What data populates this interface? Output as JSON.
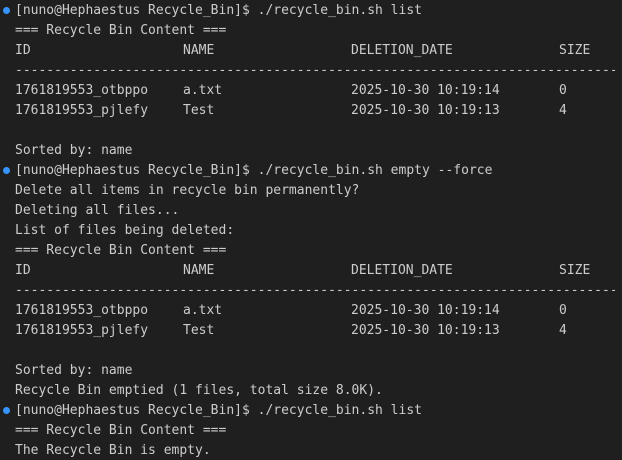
{
  "theme": {
    "background": "#1f1f1f",
    "foreground": "#cccccc",
    "prompt_dot": "#3794ff"
  },
  "prompt_dot_icon": "circle-icon",
  "lines": [
    {
      "type": "prompt",
      "text": "[nuno@Hephaestus Recycle_Bin]$ ./recycle_bin.sh list"
    },
    {
      "type": "text",
      "text": "=== Recycle Bin Content ==="
    },
    {
      "type": "row",
      "cells": [
        "ID",
        "NAME",
        "DELETION_DATE",
        "SIZE"
      ]
    },
    {
      "type": "sep",
      "text": "--------------------------------------------------------------------------------"
    },
    {
      "type": "row",
      "cells": [
        "1761819553_otbppo",
        "a.txt",
        "2025-10-30 10:19:14",
        "0"
      ]
    },
    {
      "type": "row",
      "cells": [
        "1761819553_pjlefy",
        "Test",
        "2025-10-30 10:19:13",
        "4"
      ]
    },
    {
      "type": "blank",
      "text": ""
    },
    {
      "type": "text",
      "text": "Sorted by: name"
    },
    {
      "type": "prompt",
      "text": "[nuno@Hephaestus Recycle_Bin]$ ./recycle_bin.sh empty --force"
    },
    {
      "type": "text",
      "text": "Delete all items in recycle bin permanently?"
    },
    {
      "type": "text",
      "text": "Deleting all files..."
    },
    {
      "type": "text",
      "text": "List of files being deleted:"
    },
    {
      "type": "text",
      "text": "=== Recycle Bin Content ==="
    },
    {
      "type": "row",
      "cells": [
        "ID",
        "NAME",
        "DELETION_DATE",
        "SIZE"
      ]
    },
    {
      "type": "sep",
      "text": "--------------------------------------------------------------------------------"
    },
    {
      "type": "row",
      "cells": [
        "1761819553_otbppo",
        "a.txt",
        "2025-10-30 10:19:14",
        "0"
      ]
    },
    {
      "type": "row",
      "cells": [
        "1761819553_pjlefy",
        "Test",
        "2025-10-30 10:19:13",
        "4"
      ]
    },
    {
      "type": "blank",
      "text": ""
    },
    {
      "type": "text",
      "text": "Sorted by: name"
    },
    {
      "type": "text",
      "text": "Recycle Bin emptied (1 files, total size 8.0K)."
    },
    {
      "type": "prompt",
      "text": "[nuno@Hephaestus Recycle_Bin]$ ./recycle_bin.sh list"
    },
    {
      "type": "text",
      "text": "=== Recycle Bin Content ==="
    },
    {
      "type": "text",
      "text": "The Recycle Bin is empty."
    }
  ]
}
